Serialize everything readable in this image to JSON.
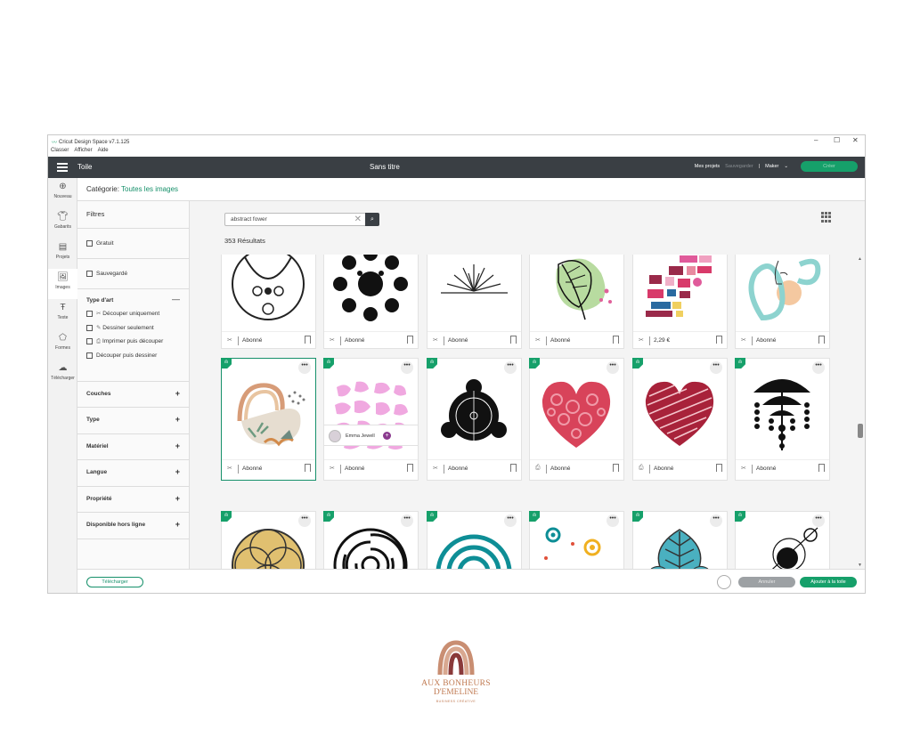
{
  "window": {
    "title": "Cricut Design Space  v7.1.125",
    "controls": [
      "–",
      "☐",
      "✕"
    ],
    "menu": [
      "Classer",
      "Afficher",
      "Aide"
    ]
  },
  "topbar": {
    "section": "Toile",
    "document": "Sans titre",
    "my_projects": "Mes projets",
    "save": "Sauvegarder",
    "separator": "|",
    "machine": "Maker",
    "create": "Créer"
  },
  "rail": [
    "Nouveau",
    "Gabarits",
    "Projets",
    "Images",
    "Texte",
    "Formes",
    "Télécharger"
  ],
  "category": {
    "label": "Catégorie:",
    "value": "Toutes les images"
  },
  "filters": {
    "title": "Filtres",
    "free": "Gratuit",
    "saved": "Sauvegardé",
    "art_type": "Type d'art",
    "art_type_toggle": "—",
    "art_options": [
      "Découper uniquement",
      "Dessiner seulement",
      "Imprimer puis découper",
      "Découper puis dessiner"
    ],
    "sections": [
      "Couches",
      "Type",
      "Matériel",
      "Langue",
      "Propriété",
      "Disponible hors ligne"
    ],
    "expand": "+"
  },
  "search": {
    "value": "abstract fower",
    "clear": "✕",
    "button": "⌕"
  },
  "results": "353 Résultats",
  "cards": {
    "subscribed": "Abonné",
    "price": "2,29 €",
    "menu": "•••"
  },
  "designer": {
    "name": "Emma Jewell",
    "follow": "+"
  },
  "bottombar": {
    "upload": "Télécharger",
    "cancel": "Annuler",
    "add": "Ajouter à la toile"
  },
  "logo": {
    "line1": "AUX BONHEURS",
    "line2": "D'EMELINE",
    "line3": "BUSINESS CRÉATIVE"
  },
  "colors": {
    "accent": "#16a06a",
    "topbar": "#3a3f44"
  }
}
